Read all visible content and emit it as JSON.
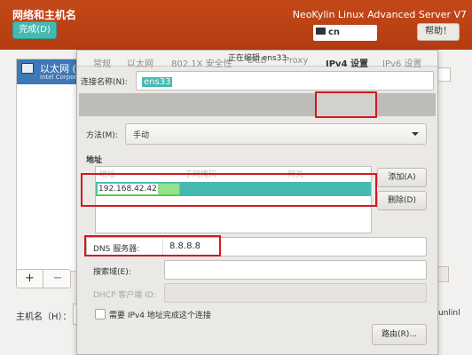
{
  "header": {
    "page_title": "网络和主机名",
    "done_label": "完成(D)",
    "product": "NeoKylin Linux Advanced Server V7",
    "keyboard_layout": "cn",
    "help_label": "帮助！"
  },
  "sidebar": {
    "connection_name": "以太网 (e",
    "connection_desc": "Intel Corpora",
    "add_label": "+",
    "remove_label": "−"
  },
  "hostname": {
    "label": "主机名（H）：",
    "right_text": "unlinl"
  },
  "dialog": {
    "title": "正在编辑 ens33",
    "conn_name_label": "连接名称(N):",
    "conn_name_value": "ens33",
    "tabs": [
      "常规",
      "以太网",
      "802.1X 安全性",
      "DCB",
      "Proxy",
      "IPv4 设置",
      "IPv6 设置"
    ],
    "active_tab": "IPv4 设置",
    "method_label": "方法(M):",
    "method_value": "手动",
    "address_section": "地址",
    "address_columns": [
      "地址",
      "子网掩码",
      "网关"
    ],
    "address_rows": [
      {
        "address": "192.168.42.42",
        "netmask": "",
        "gateway": ""
      }
    ],
    "add_label": "添加(A)",
    "delete_label": "删除(D)",
    "dns_label": "DNS 服务器:",
    "dns_value": "8.8.8.8",
    "search_label": "搜索域(E):",
    "search_value": "",
    "dhcp_label": "DHCP 客户端 ID:",
    "require_ipv4_label": "需要 IPv4 地址完成这个连接",
    "require_ipv4_checked": false,
    "routes_label": "路由(R)..."
  },
  "colors": {
    "header_bg": "#b53c10",
    "accent": "#46b9b0",
    "highlight_border": "#d2191e",
    "selection_blue": "#3f78b6"
  }
}
